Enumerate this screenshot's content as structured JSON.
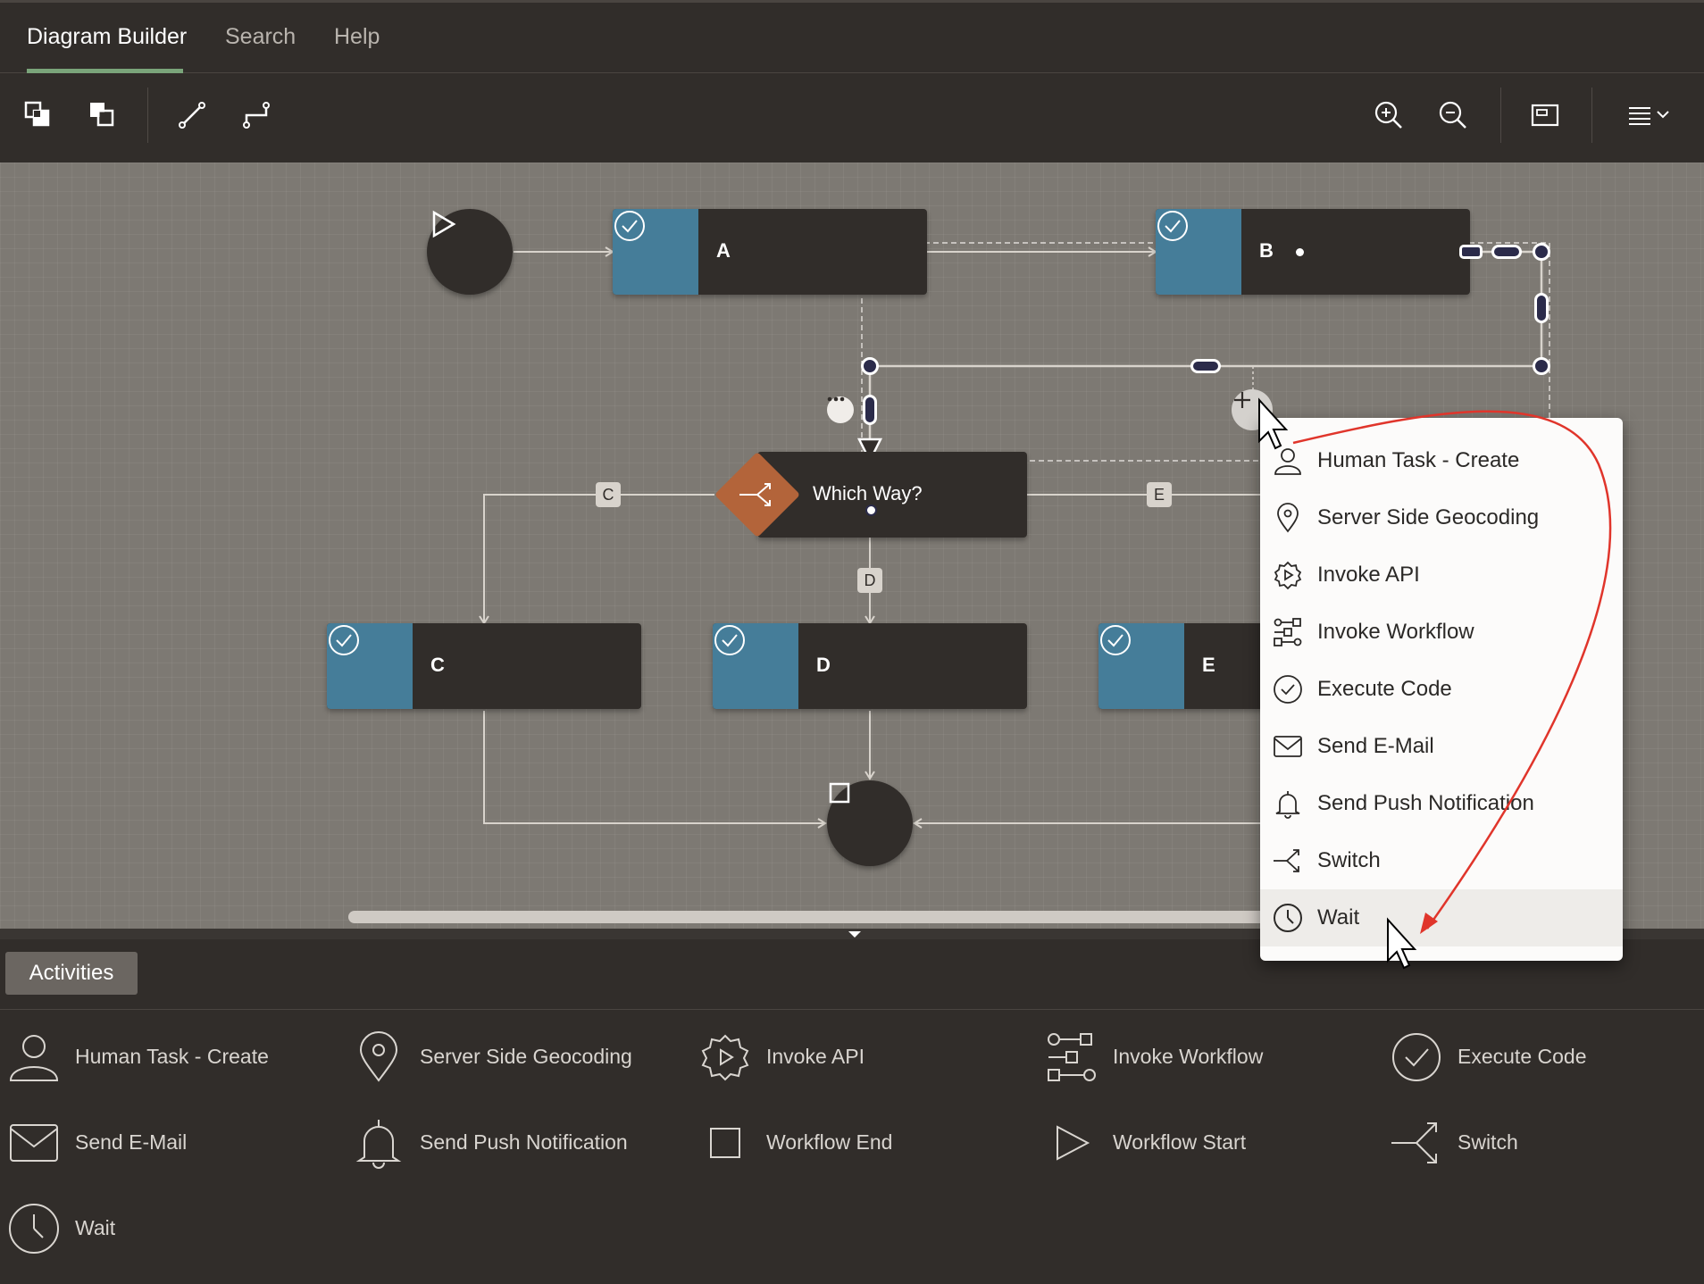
{
  "tabs": [
    "Diagram Builder",
    "Search",
    "Help"
  ],
  "toolbar": {
    "icons": [
      "bring-forward-icon",
      "send-backward-icon",
      "straight-connector-icon",
      "orthogonal-connector-icon",
      "zoom-in-icon",
      "zoom-out-icon",
      "fit-view-icon",
      "menu-icon"
    ]
  },
  "diagram": {
    "nodes": {
      "a": "A",
      "b": "B",
      "c": "C",
      "d": "D",
      "e": "E",
      "switch": "Which Way?"
    },
    "connector_labels": {
      "c": "C",
      "d": "D",
      "e": "E"
    },
    "colors": {
      "task_icon": "#457d99",
      "switch": "#b3643a",
      "canvas": "#7d7973",
      "node": "#312d2a",
      "annotation_arrow": "#e0352b"
    }
  },
  "popup": {
    "items": [
      "Human Task - Create",
      "Server Side Geocoding",
      "Invoke API",
      "Invoke Workflow",
      "Execute Code",
      "Send E-Mail",
      "Send Push Notification",
      "Switch",
      "Wait"
    ],
    "highlighted": "Wait"
  },
  "palette": {
    "tab": "Activities",
    "items": [
      "Human Task - Create",
      "Server Side Geocoding",
      "Invoke API",
      "Invoke Workflow",
      "Execute Code",
      "Send E-Mail",
      "Send Push Notification",
      "Workflow End",
      "Workflow Start",
      "Switch",
      "Wait"
    ]
  }
}
